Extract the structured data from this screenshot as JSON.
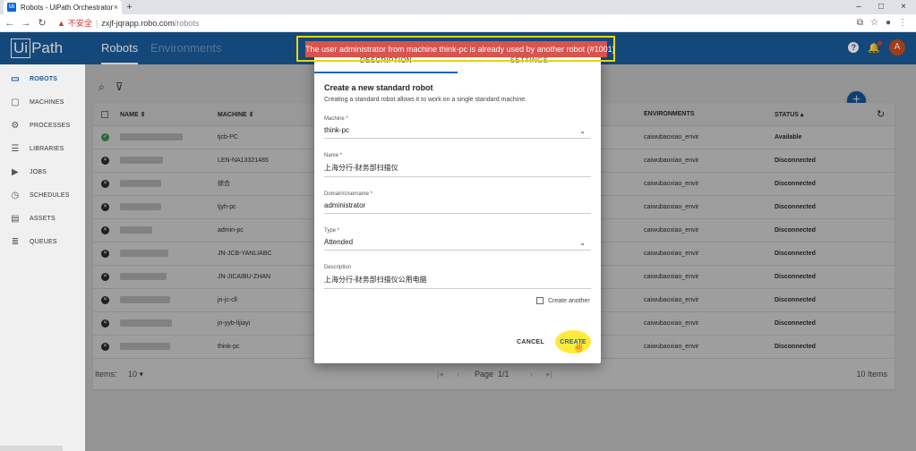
{
  "browser": {
    "tab_title": "Robots - UiPath Orchestrator",
    "favicon": "Ui",
    "security_label": "不安全",
    "url_host": "zxjf-jqrapp.robo.com",
    "url_path": "/robots"
  },
  "app": {
    "logo_ui": "Ui",
    "logo_text": "Path",
    "tabs": [
      {
        "label": "Robots"
      },
      {
        "label": "Environments"
      }
    ],
    "avatar": "A"
  },
  "sidebar": {
    "items": [
      {
        "label": "ROBOTS",
        "icon": "robot-icon"
      },
      {
        "label": "MACHINES",
        "icon": "monitor-icon"
      },
      {
        "label": "PROCESSES",
        "icon": "gears-icon"
      },
      {
        "label": "LIBRARIES",
        "icon": "library-icon"
      },
      {
        "label": "JOBS",
        "icon": "play-icon"
      },
      {
        "label": "SCHEDULES",
        "icon": "clock-icon"
      },
      {
        "label": "ASSETS",
        "icon": "assets-icon"
      },
      {
        "label": "QUEUES",
        "icon": "queue-icon"
      }
    ]
  },
  "table": {
    "headers": {
      "name": "NAME",
      "machine": "MACHINE",
      "environments": "ENVIRONMENTS",
      "status": "STATUS"
    },
    "rows": [
      {
        "machine": "tjcb-PC",
        "env": "caiwubaoxiao_envir",
        "status": "Available",
        "ok": true
      },
      {
        "machine": "LEN-NA13321485",
        "env": "caiwubaoxiao_envir",
        "status": "Disconnected",
        "ok": false
      },
      {
        "machine": "综合",
        "env": "caiwubaoxiao_envir",
        "status": "Disconnected",
        "ok": false
      },
      {
        "machine": "tjyh-pc",
        "env": "caiwubaoxiao_envir",
        "status": "Disconnected",
        "ok": false
      },
      {
        "machine": "admin-pc",
        "env": "caiwubaoxiao_envir",
        "status": "Disconnected",
        "ok": false
      },
      {
        "machine": "JN-JCB-YANLIABC",
        "env": "caiwubaoxiao_envir",
        "status": "Disconnected",
        "ok": false
      },
      {
        "machine": "JN-JICAIBU-ZHAN",
        "env": "caiwubaoxiao_envir",
        "status": "Disconnected",
        "ok": false
      },
      {
        "machine": "jn-jc-cll",
        "env": "caiwubaoxiao_envir",
        "status": "Disconnected",
        "ok": false
      },
      {
        "machine": "jn-yyb-lijiayi",
        "env": "caiwubaoxiao_envir",
        "status": "Disconnected",
        "ok": false
      },
      {
        "machine": "think-pc",
        "env": "caiwubaoxiao_envir",
        "status": "Disconnected",
        "ok": false
      }
    ],
    "footer": {
      "items_label": "Items:",
      "items_value": "10",
      "page_label": "Page",
      "page_value": "1/1",
      "total": "10 Items"
    }
  },
  "dialog": {
    "tabs": [
      "DESCRIPTION",
      "SETTINGS"
    ],
    "title": "Create a new standard robot",
    "subtitle": "Creating a standard robot allows it to work on a single standard machine.",
    "fields": {
      "machine": {
        "label": "Machine *",
        "value": "think-pc"
      },
      "name": {
        "label": "Name *",
        "value": "上海分行-财务部扫描仪"
      },
      "username": {
        "label": "Domain\\Username *",
        "value": "administrator"
      },
      "type": {
        "label": "Type *",
        "value": "Attended"
      },
      "description": {
        "label": "Description",
        "value": "上海分行-财务部扫描仪公用电脑"
      }
    },
    "create_another": "Create another",
    "cancel": "CANCEL",
    "create": "CREATE"
  },
  "error": {
    "message": "The user administrator from machine think-pc is already used by another robot (#1001)"
  },
  "colors": {
    "appbar": "#1a5a9a",
    "error": "#d9534f",
    "highlight": "#ffeb3b"
  }
}
